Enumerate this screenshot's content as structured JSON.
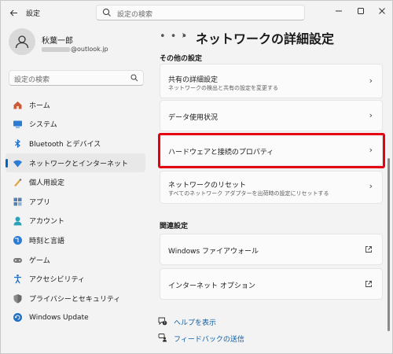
{
  "titlebar": {
    "back_icon": "back-arrow-icon",
    "app_title": "設定",
    "search_placeholder": "設定の検索",
    "minimize_icon": "minimize-icon",
    "maximize_icon": "maximize-icon",
    "close_icon": "close-icon"
  },
  "user": {
    "name": "秋葉一郎",
    "email_suffix": "@outlook.jp"
  },
  "sidebar": {
    "search_placeholder": "設定の検索",
    "items": [
      {
        "label": "ホーム",
        "icon": "home-icon"
      },
      {
        "label": "システム",
        "icon": "system-icon"
      },
      {
        "label": "Bluetooth とデバイス",
        "icon": "bluetooth-icon"
      },
      {
        "label": "ネットワークとインターネット",
        "icon": "network-icon",
        "active": true
      },
      {
        "label": "個人用設定",
        "icon": "personalization-icon"
      },
      {
        "label": "アプリ",
        "icon": "apps-icon"
      },
      {
        "label": "アカウント",
        "icon": "accounts-icon"
      },
      {
        "label": "時刻と言語",
        "icon": "time-language-icon"
      },
      {
        "label": "ゲーム",
        "icon": "gaming-icon"
      },
      {
        "label": "アクセシビリティ",
        "icon": "accessibility-icon"
      },
      {
        "label": "プライバシーとセキュリティ",
        "icon": "privacy-shield-icon"
      },
      {
        "label": "Windows Update",
        "icon": "windows-update-icon"
      }
    ]
  },
  "main": {
    "breadcrumb_more": "• • •",
    "breadcrumb_sep": "›",
    "title": "ネットワークの詳細設定",
    "section_other": "その他の設定",
    "cards": [
      {
        "title": "共有の詳細設定",
        "subtitle": "ネットワークの検出と共有の設定を変更する"
      },
      {
        "title": "データ使用状況",
        "subtitle": ""
      },
      {
        "title": "ハードウェアと接続のプロパティ",
        "subtitle": "",
        "highlighted": true
      },
      {
        "title": "ネットワークのリセット",
        "subtitle": "すべてのネットワーク アダプターを出荷時の設定にリセットする"
      }
    ],
    "section_related": "関連設定",
    "related": [
      {
        "title": "Windows ファイアウォール"
      },
      {
        "title": "インターネット オプション"
      }
    ],
    "help": "ヘルプを表示",
    "feedback": "フィードバックの送信"
  },
  "colors": {
    "accent": "#0067c0",
    "highlight_box": "#e50012",
    "link": "#0f5fa8"
  }
}
